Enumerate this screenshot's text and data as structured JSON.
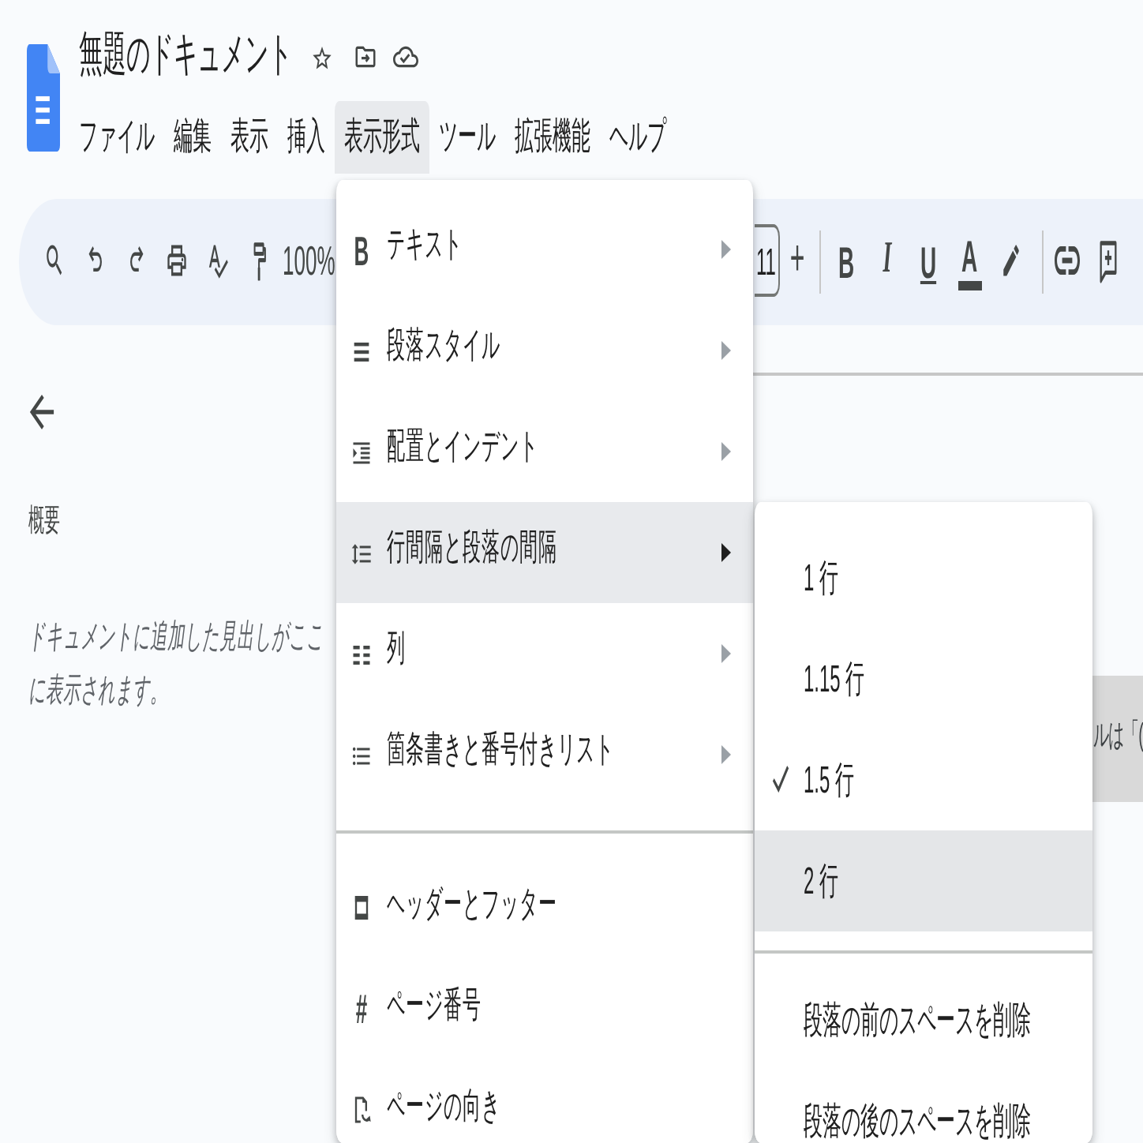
{
  "document": {
    "title": "無題のドキュメント"
  },
  "menubar": [
    {
      "label": "ファイル",
      "selected": false
    },
    {
      "label": "編集",
      "selected": false
    },
    {
      "label": "表示",
      "selected": false
    },
    {
      "label": "挿入",
      "selected": false
    },
    {
      "label": "表示形式",
      "selected": true
    },
    {
      "label": "ツール",
      "selected": false
    },
    {
      "label": "拡張機能",
      "selected": false
    },
    {
      "label": "ヘルプ",
      "selected": false
    }
  ],
  "toolbar": {
    "zoom": "100%",
    "font_size": "11",
    "increase_font": "+",
    "format_buttons": [
      {
        "kind": "bold",
        "label": "B"
      },
      {
        "kind": "italic",
        "label": "I"
      },
      {
        "kind": "underline",
        "label": "U"
      },
      {
        "kind": "text_color",
        "label": "A"
      }
    ]
  },
  "outline": {
    "title": "概要",
    "empty_message": "ドキュメントに追加した見出しがここに表示されます。"
  },
  "tooltip": {
    "text": "ルは「("
  },
  "format_menu": {
    "sections": [
      [
        {
          "label": "テキスト",
          "glyph": "B",
          "has_submenu": true,
          "expanded": false
        },
        {
          "label": "段落スタイル",
          "has_submenu": true,
          "expanded": false
        },
        {
          "label": "配置とインデント",
          "has_submenu": true,
          "expanded": false
        },
        {
          "label": "行間隔と段落の間隔",
          "has_submenu": true,
          "expanded": true
        },
        {
          "label": "列",
          "has_submenu": true,
          "expanded": false
        },
        {
          "label": "箇条書きと番号付きリスト",
          "has_submenu": true,
          "expanded": false
        }
      ],
      [
        {
          "label": "ヘッダーとフッター",
          "has_submenu": false,
          "expanded": false
        },
        {
          "label": "ページ番号",
          "glyph": "#",
          "has_submenu": false,
          "expanded": false
        },
        {
          "label": "ページの向き",
          "has_submenu": false,
          "expanded": false
        }
      ]
    ]
  },
  "line_spacing_menu": {
    "sections": [
      [
        {
          "label": "1 行",
          "checked": false,
          "hovered": false
        },
        {
          "label": "1.15 行",
          "checked": false,
          "hovered": false
        },
        {
          "label": "1.5 行",
          "checked": true,
          "hovered": false
        },
        {
          "label": "2 行",
          "checked": false,
          "hovered": true
        }
      ],
      [
        {
          "label": "段落の前のスペースを削除",
          "checked": false,
          "hovered": false
        },
        {
          "label": "段落の後のスペースを削除",
          "checked": false,
          "hovered": false
        }
      ]
    ]
  }
}
